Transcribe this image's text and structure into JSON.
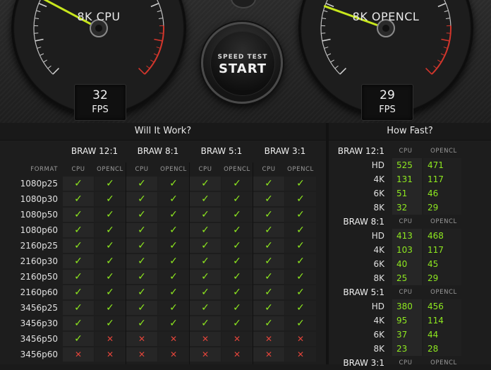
{
  "gauges": {
    "cpu": {
      "title": "8K CPU",
      "fps": "32",
      "unit": "FPS",
      "needle_fraction": 0.27
    },
    "opencl": {
      "title": "8K OPENCL",
      "fps": "29",
      "unit": "FPS",
      "needle_fraction": 0.24
    }
  },
  "start_button": {
    "small": "SPEED TEST",
    "big": "START"
  },
  "will_it_work": {
    "title": "Will It Work?",
    "format_header": "FORMAT",
    "groups": [
      "BRAW 12:1",
      "BRAW 8:1",
      "BRAW 5:1",
      "BRAW 3:1"
    ],
    "columns": [
      "CPU",
      "OPENCL"
    ],
    "rows": [
      {
        "format": "1080p25",
        "cells": [
          1,
          1,
          1,
          1,
          1,
          1,
          1,
          1
        ]
      },
      {
        "format": "1080p30",
        "cells": [
          1,
          1,
          1,
          1,
          1,
          1,
          1,
          1
        ]
      },
      {
        "format": "1080p50",
        "cells": [
          1,
          1,
          1,
          1,
          1,
          1,
          1,
          1
        ]
      },
      {
        "format": "1080p60",
        "cells": [
          1,
          1,
          1,
          1,
          1,
          1,
          1,
          1
        ]
      },
      {
        "format": "2160p25",
        "cells": [
          1,
          1,
          1,
          1,
          1,
          1,
          1,
          1
        ]
      },
      {
        "format": "2160p30",
        "cells": [
          1,
          1,
          1,
          1,
          1,
          1,
          1,
          1
        ]
      },
      {
        "format": "2160p50",
        "cells": [
          1,
          1,
          1,
          1,
          1,
          1,
          1,
          1
        ]
      },
      {
        "format": "2160p60",
        "cells": [
          1,
          1,
          1,
          1,
          1,
          1,
          1,
          1
        ]
      },
      {
        "format": "3456p25",
        "cells": [
          1,
          1,
          1,
          1,
          1,
          1,
          1,
          1
        ]
      },
      {
        "format": "3456p30",
        "cells": [
          1,
          1,
          1,
          1,
          1,
          1,
          1,
          1
        ]
      },
      {
        "format": "3456p50",
        "cells": [
          1,
          0,
          0,
          0,
          0,
          0,
          0,
          0
        ]
      },
      {
        "format": "3456p60",
        "cells": [
          0,
          0,
          0,
          0,
          0,
          0,
          0,
          0
        ]
      }
    ],
    "symbols": {
      "ok": "✓",
      "no": "✕"
    }
  },
  "how_fast": {
    "title": "How Fast?",
    "columns": [
      "CPU",
      "OPENCL"
    ],
    "groups": [
      {
        "name": "BRAW 12:1",
        "rows": [
          {
            "res": "HD",
            "cpu": "525",
            "opencl": "471"
          },
          {
            "res": "4K",
            "cpu": "131",
            "opencl": "117"
          },
          {
            "res": "6K",
            "cpu": "51",
            "opencl": "46"
          },
          {
            "res": "8K",
            "cpu": "32",
            "opencl": "29"
          }
        ]
      },
      {
        "name": "BRAW 8:1",
        "rows": [
          {
            "res": "HD",
            "cpu": "413",
            "opencl": "468"
          },
          {
            "res": "4K",
            "cpu": "103",
            "opencl": "117"
          },
          {
            "res": "6K",
            "cpu": "40",
            "opencl": "45"
          },
          {
            "res": "8K",
            "cpu": "25",
            "opencl": "29"
          }
        ]
      },
      {
        "name": "BRAW 5:1",
        "rows": [
          {
            "res": "HD",
            "cpu": "380",
            "opencl": "456"
          },
          {
            "res": "4K",
            "cpu": "95",
            "opencl": "114"
          },
          {
            "res": "6K",
            "cpu": "37",
            "opencl": "44"
          },
          {
            "res": "8K",
            "cpu": "23",
            "opencl": "28"
          }
        ]
      },
      {
        "name": "BRAW 3:1",
        "rows": []
      }
    ]
  }
}
